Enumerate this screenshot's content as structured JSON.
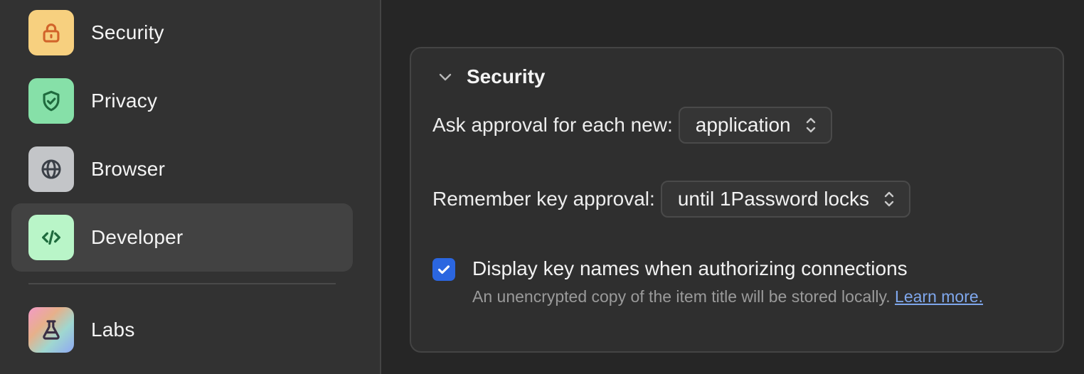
{
  "sidebar": {
    "items": [
      {
        "label": "Security",
        "icon": "lock-icon",
        "color": "#f7d07f",
        "selected": false
      },
      {
        "label": "Privacy",
        "icon": "shield-check-icon",
        "color": "#86e0a8",
        "selected": false
      },
      {
        "label": "Browser",
        "icon": "globe-icon",
        "color": "#c3c5c8",
        "selected": false
      },
      {
        "label": "Developer",
        "icon": "code-icon",
        "color": "#b9f5c8",
        "selected": true
      },
      {
        "label": "Labs",
        "icon": "flask-icon",
        "color": "gradient",
        "selected": false
      }
    ]
  },
  "section": {
    "title": "Security",
    "ask_approval": {
      "label": "Ask approval for each new:",
      "value": "application"
    },
    "remember_approval": {
      "label": "Remember key approval:",
      "value": "until 1Password locks"
    },
    "display_key_names": {
      "checked": true,
      "label": "Display key names when authorizing connections",
      "help": "An unencrypted copy of the item title will be stored locally. ",
      "link": "Learn more."
    }
  },
  "colors": {
    "accent": "#2b66e0",
    "link": "#7fa7ec"
  }
}
